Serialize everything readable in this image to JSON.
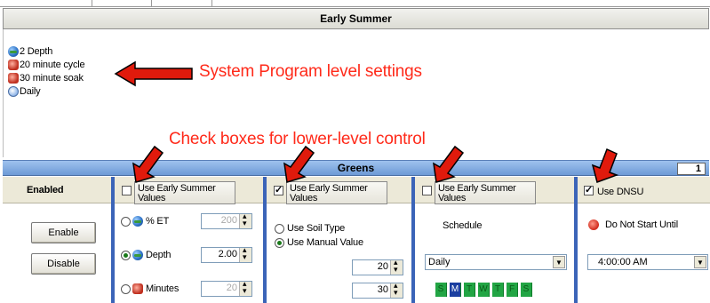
{
  "window": {
    "title": "Early Summer"
  },
  "program_settings": [
    {
      "icon": "globe-icon",
      "label": "2 Depth"
    },
    {
      "icon": "clock-icon",
      "label": "20 minute cycle"
    },
    {
      "icon": "clock-icon",
      "label": "30 minute soak"
    },
    {
      "icon": "calendar-icon",
      "label": "Daily"
    }
  ],
  "annotations": {
    "system_program": "System Program level settings",
    "check_boxes": "Check boxes for lower-level control"
  },
  "group": {
    "name": "Greens",
    "number": "1"
  },
  "enabled_panel": {
    "header": "Enabled",
    "enable": "Enable",
    "disable": "Disable"
  },
  "et_panel": {
    "use_label": "Use Early Summer Values",
    "checked": false,
    "rows": [
      {
        "label": "% ET",
        "value": "200",
        "disabled": true
      },
      {
        "label": "Depth",
        "value": "2.00",
        "disabled": false
      },
      {
        "label": "Minutes",
        "value": "20",
        "disabled": true
      }
    ]
  },
  "soil_panel": {
    "use_label": "Use Early Summer Values",
    "checked": true,
    "option_soil": "Use Soil Type",
    "option_manual": "Use Manual Value",
    "selected": "Use Manual Value",
    "cycle_value": "20",
    "soak_value": "30"
  },
  "schedule_panel": {
    "use_label": "Use Early Summer Values",
    "checked": false,
    "label": "Schedule",
    "dropdown": "Daily",
    "days": [
      "S",
      "M",
      "T",
      "W",
      "T",
      "F",
      "S"
    ],
    "selected_day_index": 1
  },
  "dnsu_panel": {
    "use_label": "Use DNSU",
    "checked": true,
    "label": "Do Not Start Until",
    "time": "4:00:00 AM"
  },
  "colors": {
    "annotation": "#ff2a1a",
    "group_bar": "#7da7dd",
    "column_separator": "#3b64b8",
    "day_green": "#22a544"
  }
}
